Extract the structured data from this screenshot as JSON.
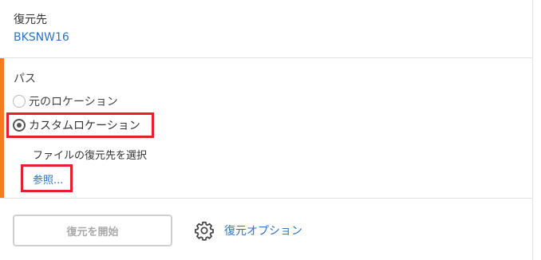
{
  "destination": {
    "label": "復元先",
    "value": "BKSNW16"
  },
  "path": {
    "label": "パス",
    "options": [
      {
        "label": "元のロケーション",
        "selected": false
      },
      {
        "label": "カスタムロケーション",
        "selected": true
      }
    ],
    "file_destination_label": "ファイルの復元先を選択",
    "browse_label": "参照..."
  },
  "actions": {
    "start_restore_label": "復元を開始",
    "restore_options_label": "復元オプション",
    "restore_options_icon": "gear-icon"
  },
  "colors": {
    "accent": "#f47b20",
    "link": "#2a74c9",
    "highlight": "#e5202a"
  }
}
